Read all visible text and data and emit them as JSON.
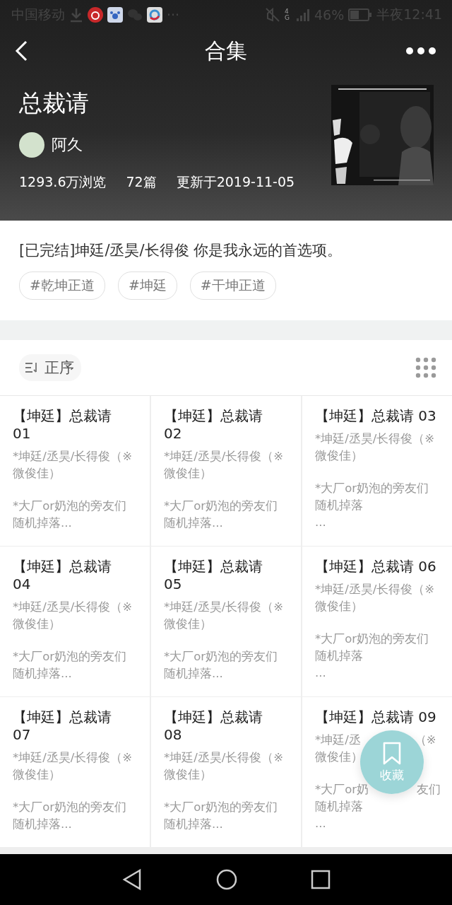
{
  "status_bar": {
    "carrier": "中国移动",
    "more": "···",
    "network": "4G",
    "battery": "46%",
    "time": "半夜12:41"
  },
  "nav": {
    "title": "合集"
  },
  "collection": {
    "title": "总裁请",
    "author": "阿久",
    "views": "1293.6万浏览",
    "count": "72篇",
    "updated": "更新于2019-11-05"
  },
  "intro": {
    "description": "[已完结]坤廷/丞昊/长得俊 你是我永远的首选项。",
    "tags": [
      "#乾坤正道",
      "#坤廷",
      "#干坤正道"
    ]
  },
  "sort": {
    "label": "正序"
  },
  "chapters": [
    {
      "title": [
        "【坤廷】总裁请",
        "01"
      ],
      "paragraphs": [
        [
          "*坤廷/丞昊/长得俊（※",
          "微俊佳）"
        ],
        [
          "*大厂or奶泡的旁友们",
          "随机掉落..."
        ]
      ]
    },
    {
      "title": [
        "【坤廷】总裁请",
        "02"
      ],
      "paragraphs": [
        [
          "*坤廷/丞昊/长得俊（※",
          "微俊佳）"
        ],
        [
          "*大厂or奶泡的旁友们",
          "随机掉落..."
        ]
      ]
    },
    {
      "title": [
        "【坤廷】总裁请 03"
      ],
      "paragraphs": [
        [
          "*坤廷/丞昊/长得俊（※",
          "微俊佳）"
        ],
        [
          "*大厂or奶泡的旁友们",
          "随机掉落",
          "..."
        ]
      ]
    },
    {
      "title": [
        "【坤廷】总裁请",
        "04"
      ],
      "paragraphs": [
        [
          "*坤廷/丞昊/长得俊（※",
          "微俊佳）"
        ],
        [
          "*大厂or奶泡的旁友们",
          "随机掉落..."
        ]
      ]
    },
    {
      "title": [
        "【坤廷】总裁请",
        "05"
      ],
      "paragraphs": [
        [
          "*坤廷/丞昊/长得俊（※",
          "微俊佳）"
        ],
        [
          "*大厂or奶泡的旁友们",
          "随机掉落..."
        ]
      ]
    },
    {
      "title": [
        "【坤廷】总裁请 06"
      ],
      "paragraphs": [
        [
          "*坤廷/丞昊/长得俊（※",
          "微俊佳）"
        ],
        [
          "*大厂or奶泡的旁友们",
          "随机掉落",
          "..."
        ]
      ]
    },
    {
      "title": [
        "【坤廷】总裁请",
        "07"
      ],
      "paragraphs": [
        [
          "*坤廷/丞昊/长得俊（※",
          "微俊佳）"
        ],
        [
          "*大厂or奶泡的旁友们",
          "随机掉落..."
        ]
      ]
    },
    {
      "title": [
        "【坤廷】总裁请",
        "08"
      ],
      "paragraphs": [
        [
          "*坤廷/丞昊/长得俊（※",
          "微俊佳）"
        ],
        [
          "*大厂or奶泡的旁友们",
          "随机掉落..."
        ]
      ]
    },
    {
      "title": [
        "【坤廷】总裁请 09"
      ],
      "paragraphs": [
        [
          [
            "*坤廷/丞",
            "（※"
          ],
          "微俊佳）"
        ],
        [
          [
            "*大厂or奶",
            "友们"
          ],
          "随机掉落",
          "..."
        ]
      ]
    }
  ],
  "fab": {
    "label": "收藏"
  }
}
